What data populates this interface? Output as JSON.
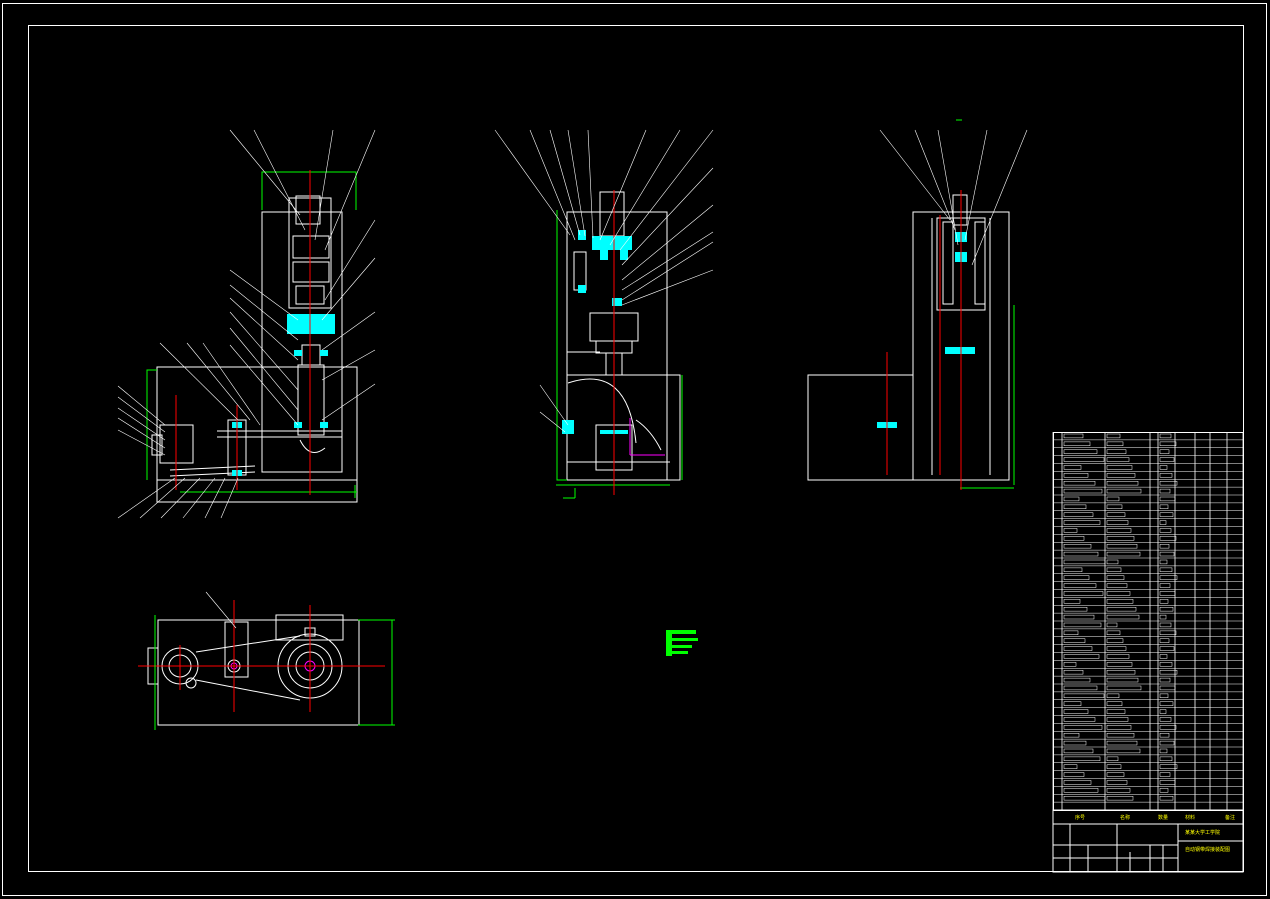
{
  "drawing": {
    "background": "#000000",
    "colors": {
      "outline": "#ffffff",
      "section": "#00ffff",
      "centerline": "#ff0000",
      "dimension": "#00ff00",
      "highlight": "#ff00ff",
      "text": "#ffff00"
    },
    "views": [
      {
        "id": "front-view"
      },
      {
        "id": "side-view"
      },
      {
        "id": "right-view"
      },
      {
        "id": "top-view"
      }
    ],
    "title_block": {
      "parts_list_rows": 48,
      "drawing_title": "自动钢带焊接装配图",
      "organization": "某某大学工学院",
      "header_labels": [
        "序号",
        "名称",
        "数量",
        "材料",
        "备注"
      ]
    }
  }
}
